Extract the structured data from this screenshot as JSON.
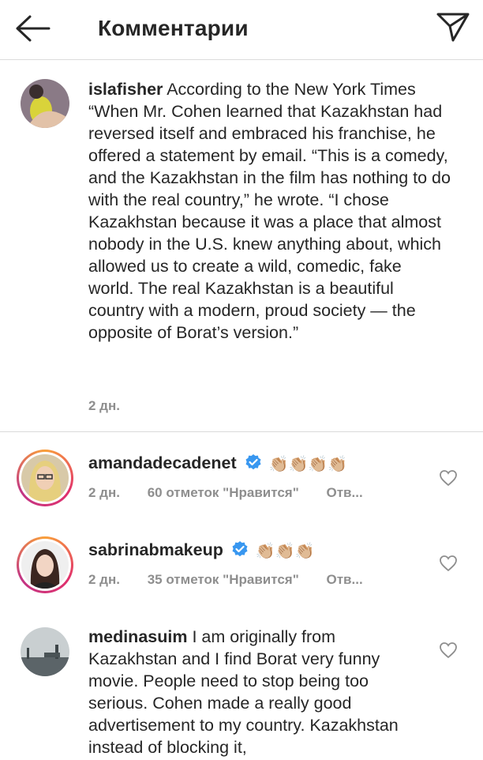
{
  "header": {
    "title": "Комментарии",
    "back_icon": "arrow-left-icon",
    "send_icon": "paper-plane-icon"
  },
  "caption": {
    "username": "islafisher",
    "text": "According to the New York Times “When Mr. Cohen learned that Kazakhstan had reversed itself and embraced his franchise, he offered a statement by email. “This is a comedy, and the Kazakhstan in the film has nothing to do with the real country,” he wrote. “I chose Kazakhstan because it was a place that almost nobody in the U.S. knew anything about, which allowed us to create a wild, comedic, fake world. The real Kazakhstan is a beautiful country with a modern, proud society — the opposite of Borat’s version.”",
    "time": "2 дн."
  },
  "comments": [
    {
      "username": "amandadecadenet",
      "verified": true,
      "text": "👏🏼👏🏼👏🏼👏🏼",
      "time": "2 дн.",
      "likes": "60 отметок \"Нравится\"",
      "reply": "Отв..."
    },
    {
      "username": "sabrinabmakeup",
      "verified": true,
      "text": "👏🏼👏🏼👏🏼",
      "time": "2 дн.",
      "likes": "35 отметок \"Нравится\"",
      "reply": "Отв..."
    },
    {
      "username": "medinasuim",
      "verified": false,
      "text": "I am originally from Kazakhstan and I find Borat very funny movie.  People need to stop being too serious. Cohen made a really good advertisement to my country. Kazakhstan instead of blocking it,"
    }
  ],
  "colors": {
    "text": "#262626",
    "secondary": "#8e8e8e",
    "verified_blue": "#3897f0",
    "divider": "#dbdbdb"
  }
}
